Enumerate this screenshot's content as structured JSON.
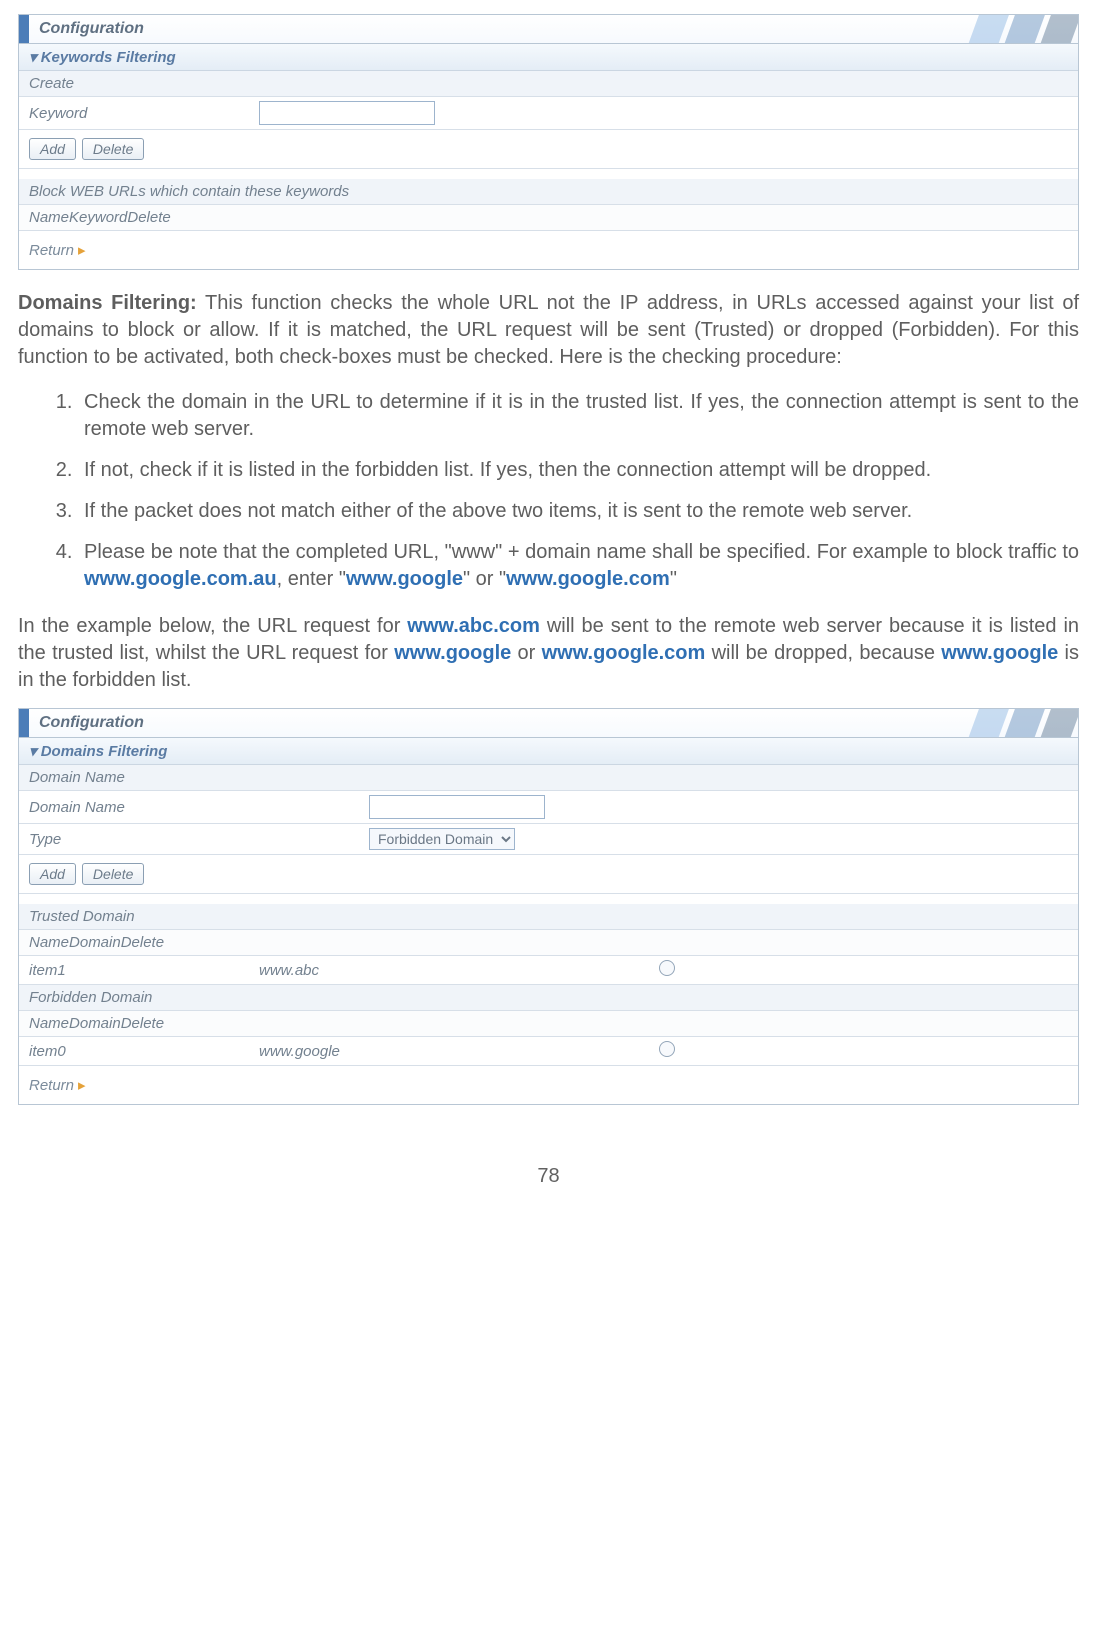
{
  "panel1": {
    "title": "Configuration",
    "section": "▾ Keywords Filtering",
    "createLabel": "Create",
    "keywordLabel": "Keyword",
    "btnAdd": "Add",
    "btnDelete": "Delete",
    "blockHeader": "Block WEB URLs which contain these keywords",
    "colName": "Name",
    "colKeyword": "Keyword",
    "colDelete": "Delete",
    "return": "Return"
  },
  "text1": {
    "heading": "Domains Filtering:",
    "body": " This function checks the whole URL not the IP address, in URLs accessed against your list of domains to block or allow.  If it is matched, the URL request will be sent (Trusted) or dropped (Forbidden).  For this function to be activated, both check-boxes must be checked.  Here is the checking procedure:"
  },
  "list": {
    "i1": "Check the domain in the URL to determine if it is in the trusted list. If yes, the connection attempt is sent to the remote web server.",
    "i2": "If not, check if it is listed in the forbidden list.  If yes, then the connection attempt will be dropped.",
    "i3": "If the packet does not match either of the above two items, it is sent to the remote web server.",
    "i4a": "Please be note that the completed URL, \"www\" + domain name shall be specified. For example to block traffic to ",
    "i4b": "www.google.com.au",
    "i4c": ", enter \"",
    "i4d": "www.google",
    "i4e": "\" or \"",
    "i4f": "www.google.com",
    "i4g": "\""
  },
  "text2": {
    "a": "In the example below, the URL request for ",
    "b": "www.abc.com",
    "c": " will be sent to the remote web server because it is listed in the trusted list, whilst the URL request for ",
    "d": "www.google",
    "e": " or ",
    "f": "www.google.com",
    "g": " will be dropped, because ",
    "h": "www.google",
    "i": " is in the forbidden list."
  },
  "panel2": {
    "title": "Configuration",
    "section": "▾ Domains Filtering",
    "domainHeader": "Domain Name",
    "domainLabel": "Domain Name",
    "typeLabel": "Type",
    "typeValue": "Forbidden Domain",
    "btnAdd": "Add",
    "btnDelete": "Delete",
    "trustedHeader": "Trusted Domain",
    "colName": "Name",
    "colDomain": "Domain",
    "colDelete": "Delete",
    "trustedRowName": "item1",
    "trustedRowDomain": "www.abc",
    "forbiddenHeader": "Forbidden Domain",
    "forbiddenRowName": "item0",
    "forbiddenRowDomain": "www.google",
    "return": "Return"
  },
  "pageNumber": "78"
}
